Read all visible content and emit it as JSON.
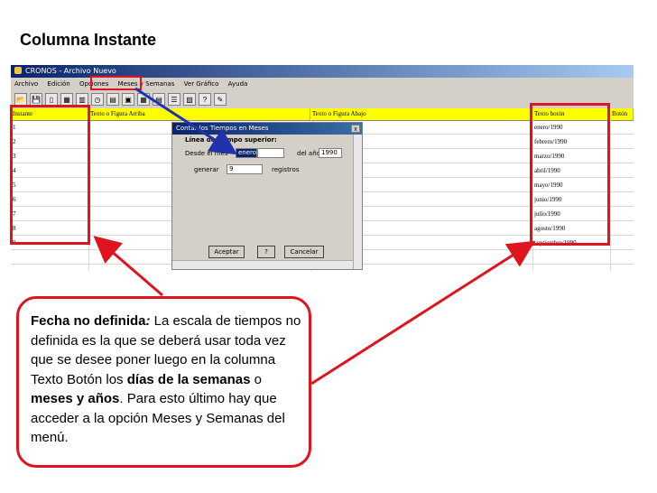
{
  "slide_title": "Columna Instante",
  "app": {
    "title": "CRONOS - Archivo Nuevo",
    "menu": [
      "Archivo",
      "Edición",
      "Opciones",
      "Meses y Semanas",
      "Ver Gráfico",
      "Ayuda"
    ],
    "toolbar_icons": [
      "open-icon",
      "save-icon",
      "new-icon",
      "table-icon",
      "columns-icon",
      "clock-icon",
      "print-icon",
      "preview-icon",
      "grid-icon",
      "rows-icon",
      "list-icon",
      "chart-icon",
      "help-icon",
      "wizard-icon"
    ]
  },
  "grid": {
    "headers": [
      "Instante",
      "Texto o Figura Arriba",
      "Texto o Figura Abajo",
      "Texto botón",
      "Botón"
    ],
    "instants": [
      "1",
      "2",
      "3",
      "4",
      "5",
      "6",
      "7",
      "8",
      "9"
    ],
    "texto_boton": [
      "enero/1990",
      "febrero/1990",
      "marzo/1990",
      "abril/1990",
      "mayo/1990",
      "junio/1990",
      "julio/1990",
      "agosto/1990",
      "septiembre/1990"
    ]
  },
  "dialog": {
    "title": "Contar los Tiempos en Meses",
    "section": "Línea de tiempo superior:",
    "from_label": "Desde el mes",
    "month_value": "enero",
    "year_label": "del año",
    "year_value": "1990",
    "generate_label": "generar",
    "generate_value": "9",
    "records_label": "registros",
    "accept": "Aceptar",
    "help": "?",
    "cancel": "Cancelar",
    "close": "x"
  },
  "callout": {
    "term": "Fecha no definida",
    "colon": ":",
    "t1": " La escala de tiempos no definida es la que se deberá usar toda vez que se desee poner luego en la columna Texto Botón los ",
    "b1": "días de la semanas",
    "t2": " o ",
    "b2": "meses y años",
    "t3": ". Para esto último hay que acceder a la opción Meses y Semanas del menú."
  },
  "colors": {
    "highlight": "#e0141e",
    "header_bg": "#ffff00",
    "blue_arrow": "#2233aa"
  }
}
